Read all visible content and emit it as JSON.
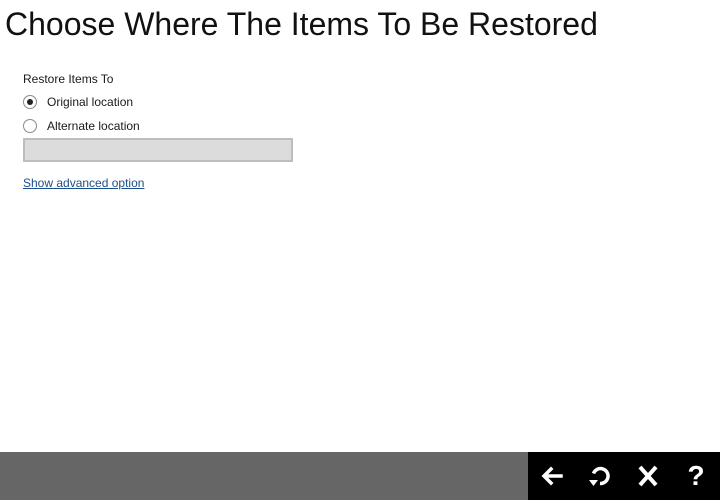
{
  "page": {
    "title": "Choose Where The Items To Be Restored"
  },
  "restore": {
    "section_label": "Restore Items To",
    "options": [
      {
        "label": "Original location",
        "selected": true
      },
      {
        "label": "Alternate location",
        "selected": false
      }
    ],
    "alternate_path": {
      "value": "",
      "placeholder": ""
    },
    "advanced_link": "Show advanced option"
  },
  "footer": {
    "buttons": [
      {
        "name": "back",
        "icon": "arrow-left-icon"
      },
      {
        "name": "restore",
        "icon": "restore-icon"
      },
      {
        "name": "cancel",
        "icon": "close-icon"
      },
      {
        "name": "help",
        "icon": "help-icon",
        "glyph": "?"
      }
    ],
    "colors": {
      "bar": "#666666",
      "actions": "#000000",
      "icon": "#ffffff"
    }
  }
}
